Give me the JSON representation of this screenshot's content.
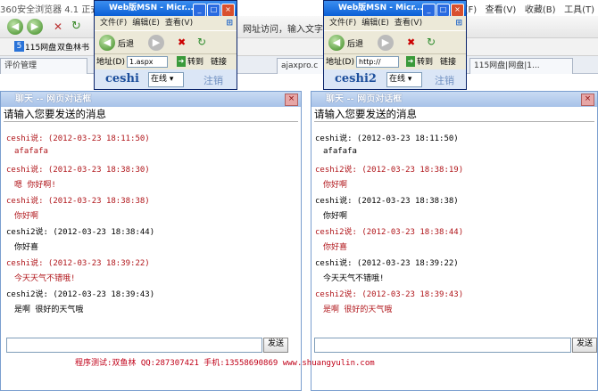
{
  "browser": {
    "title": "360安全浏览器 4.1 正式版",
    "menu": [
      "文件(F)",
      "查看(V)",
      "收藏(B)",
      "工具(T)"
    ],
    "address_hint": "网址访问，输入文字搜",
    "fav": [
      {
        "label": "115网盘"
      },
      {
        "label": "双鱼林书"
      }
    ],
    "tabs": [
      {
        "label": "评价管理"
      },
      {
        "label": "ajaxpro.c"
      },
      {
        "label": "115网盘|网盘|1..."
      }
    ]
  },
  "ie_windows": [
    {
      "title": "Web版MSN - Micr...",
      "menu": [
        "文件(F)",
        "编辑(E)",
        "查看(V)"
      ],
      "back": "后退",
      "address_label": "地址(D)",
      "address_value": "1.aspx",
      "go": "转到",
      "links": "链接",
      "user": "ceshi",
      "status": "在线",
      "logout": "注销"
    },
    {
      "title": "Web版MSN - Micr...",
      "menu": [
        "文件(F)",
        "编辑(E)",
        "查看(V)"
      ],
      "back": "后退",
      "address_label": "地址(D)",
      "address_value": "http://",
      "go": "转到",
      "links": "链接",
      "user": "ceshi2",
      "status": "在线",
      "logout": "注销"
    }
  ],
  "chats": [
    {
      "title": "聊天 -- 网页对话框",
      "header": "请输入您要发送的消息",
      "send": "发送",
      "messages": [
        {
          "meta": "ceshi说: (2012-03-23 18:11:50)",
          "text": "afafafa",
          "color": "red"
        },
        {
          "meta": "ceshi说: (2012-03-23 18:38:30)",
          "text": "嗯 你好啊!",
          "color": "red"
        },
        {
          "meta": "ceshi说: (2012-03-23 18:38:38)",
          "text": "你好啊",
          "color": "red"
        },
        {
          "meta": "ceshi2说: (2012-03-23 18:38:44)",
          "text": "你好喜",
          "color": "black"
        },
        {
          "meta": "ceshi说: (2012-03-23 18:39:22)",
          "text": "今天天气不错哦!",
          "color": "red"
        },
        {
          "meta": "ceshi2说: (2012-03-23 18:39:43)",
          "text": "是啊 很好的天气哦",
          "color": "black"
        }
      ]
    },
    {
      "title": "聊天 -- 网页对话框",
      "header": "请输入您要发送的消息",
      "send": "发送",
      "messages": [
        {
          "meta": "ceshi说: (2012-03-23 18:11:50)",
          "text": "afafafa",
          "color": "black"
        },
        {
          "meta": "ceshi2说: (2012-03-23 18:38:19)",
          "text": "你好啊",
          "color": "red"
        },
        {
          "meta": "ceshi说: (2012-03-23 18:38:38)",
          "text": "你好啊",
          "color": "black"
        },
        {
          "meta": "ceshi2说: (2012-03-23 18:38:44)",
          "text": "你好喜",
          "color": "red"
        },
        {
          "meta": "ceshi说: (2012-03-23 18:39:22)",
          "text": "今天天气不错哦!",
          "color": "black"
        },
        {
          "meta": "ceshi2说: (2012-03-23 18:39:43)",
          "text": "是啊 很好的天气哦",
          "color": "red"
        }
      ]
    }
  ],
  "footer": "程序测试:双鱼林 QQ:287307421 手机:13558690869 www.shuangyulin.com",
  "colors": {
    "red": "#b0151a",
    "title_blue": "#0a5fd6",
    "chat_title": "#a7c2e8"
  }
}
